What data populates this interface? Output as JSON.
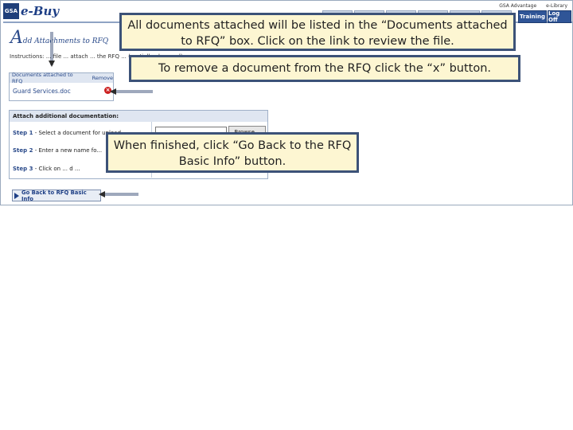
{
  "app": {
    "logo_mark": "GSA",
    "logo_text": "e-Buy",
    "top_links": [
      "GSA Advantage",
      "e-Library"
    ],
    "nav_buttons": {
      "training": "Training",
      "logoff": "Log Off"
    }
  },
  "page": {
    "title_initial": "A",
    "title_rest": "dd Attachments to RFQ",
    "instructions": "Instructions: ... file ... attach ... the RFQ ... (partially obscured)"
  },
  "documents_box": {
    "header": "Documents attached to RFQ",
    "remove_header": "Remove",
    "files": [
      {
        "name": "Guard Services.doc",
        "remove_icon": "x-circle-icon"
      }
    ]
  },
  "attach_box": {
    "header": "Attach additional documentation:",
    "steps": [
      {
        "label": "Step 1",
        "text": "- Select a document for upload"
      },
      {
        "label": "Step 2",
        "text": "- Enter a new name fo..."
      },
      {
        "label": "Step 3",
        "text": "- Click on ... d ..."
      }
    ],
    "browse_label": "Browse..."
  },
  "go_back_label": "Go Back to RFQ Basic Info",
  "callouts": {
    "documents": "All documents attached will be listed in the “Documents attached to RFQ” box.  Click on the link to review the file.",
    "remove": "To remove a document from the RFQ click the “x” button.",
    "finish": "When finished, click “Go Back to the RFQ Basic Info” button."
  },
  "colors": {
    "callout_bg": "#fdf6d2",
    "callout_border": "#3c5278",
    "brand": "#1e3f86"
  }
}
